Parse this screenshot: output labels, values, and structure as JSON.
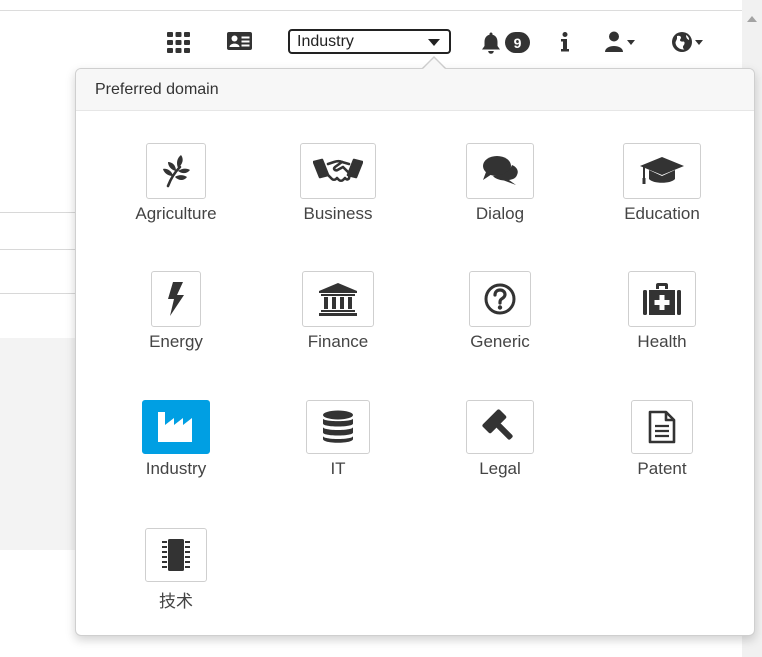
{
  "toolbar": {
    "apps_icon": "grid-icon",
    "contact_icon": "contact-card-icon",
    "domain_select_value": "Industry",
    "notifications_icon": "bell-icon",
    "notification_count": "9",
    "info_icon": "info-icon",
    "user_icon": "user-icon",
    "language_icon": "globe-icon"
  },
  "dropdown": {
    "header": "Preferred domain",
    "selected": "Industry",
    "selected_color": "#009fe3",
    "items": [
      {
        "label": "Agriculture",
        "icon": "plant-icon"
      },
      {
        "label": "Business",
        "icon": "handshake-icon"
      },
      {
        "label": "Dialog",
        "icon": "speech-bubbles-icon"
      },
      {
        "label": "Education",
        "icon": "graduation-cap-icon"
      },
      {
        "label": "Energy",
        "icon": "lightning-icon"
      },
      {
        "label": "Finance",
        "icon": "bank-icon"
      },
      {
        "label": "Generic",
        "icon": "question-circle-icon"
      },
      {
        "label": "Health",
        "icon": "medical-kit-icon"
      },
      {
        "label": "Industry",
        "icon": "factory-icon"
      },
      {
        "label": "IT",
        "icon": "database-icon"
      },
      {
        "label": "Legal",
        "icon": "gavel-icon"
      },
      {
        "label": "Patent",
        "icon": "document-icon"
      },
      {
        "label": "技术",
        "icon": "chip-icon"
      }
    ]
  }
}
